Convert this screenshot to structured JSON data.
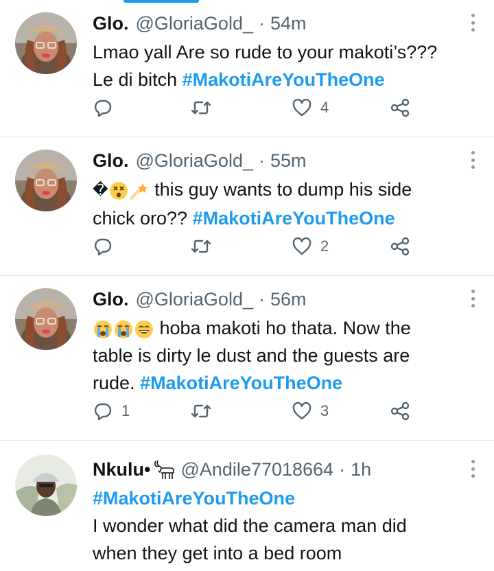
{
  "tweets": [
    {
      "name": "Glo.",
      "handle": "@GloriaGold_",
      "separator": "·",
      "time": "54m",
      "text_lines": [
        [
          "Lmao yall Are so rude to your makoti’s???"
        ],
        [
          "Le di bitch ",
          "#MakotiAreYouTheOne"
        ]
      ],
      "reply_count": "",
      "retweet_count": "",
      "like_count": "4"
    },
    {
      "name": "Glo.",
      "handle": "@GloriaGold_",
      "separator": "·",
      "time": "55m",
      "text_line1_start": "�",
      "text_line1_rest": " this guy wants to dump his side",
      "text_line2": "chick oro?? ",
      "hashtag": "#MakotiAreYouTheOne",
      "emojis": [
        "dizzy-face-emoji",
        "dizzy-emoji"
      ],
      "reply_count": "",
      "retweet_count": "",
      "like_count": "2"
    },
    {
      "name": "Glo.",
      "handle": "@GloriaGold_",
      "separator": "·",
      "time": "56m",
      "emojis": [
        "loudly-crying-emoji",
        "loudly-crying-emoji",
        "grinning-sweat-emoji"
      ],
      "text_line1_rest": " hoba makoti ho thata. Now the",
      "text_line2": "table is dirty le dust and the guests are",
      "text_line3": "rude. ",
      "hashtag": "#MakotiAreYouTheOne",
      "reply_count": "1",
      "retweet_count": "",
      "like_count": "3"
    },
    {
      "name": "Nkulu•",
      "handle": "@Andile77018664",
      "separator": "·",
      "time": "1h",
      "name_icon": "goat-icon",
      "hashtag": "#MakotiAreYouTheOne",
      "text_line2": "I wonder what did the camera man did",
      "text_line3": "when they get into a bed room"
    }
  ],
  "colors": {
    "accent": "#1d9bf0",
    "secondary_text": "#536471",
    "divider": "#dfe3e6"
  }
}
